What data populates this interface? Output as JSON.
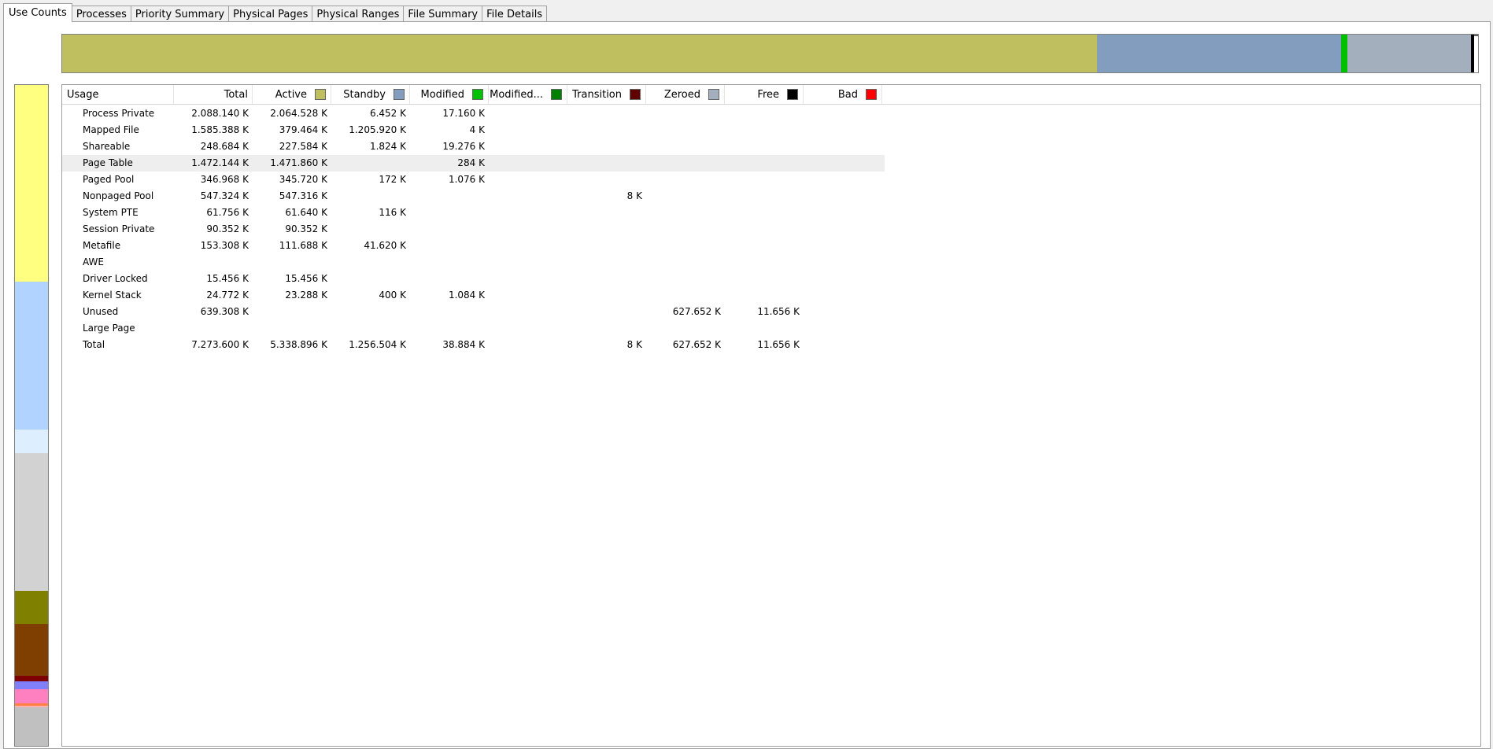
{
  "tabs": [
    {
      "label": "Use Counts",
      "active": true
    },
    {
      "label": "Processes",
      "active": false
    },
    {
      "label": "Priority Summary",
      "active": false
    },
    {
      "label": "Physical Pages",
      "active": false
    },
    {
      "label": "Physical Ranges",
      "active": false
    },
    {
      "label": "File Summary",
      "active": false
    },
    {
      "label": "File Details",
      "active": false
    }
  ],
  "memory_bar": [
    {
      "name": "Active",
      "color": "#bfbf60"
    },
    {
      "name": "Standby",
      "color": "#839dbf"
    },
    {
      "name": "Modified",
      "color": "#00c000"
    },
    {
      "name": "Zeroed",
      "color": "#a3afbd"
    },
    {
      "name": "Free",
      "color": "#000000"
    }
  ],
  "usage_bar": [
    {
      "name": "Process Private",
      "color": "#ffff80"
    },
    {
      "name": "Mapped File",
      "color": "#b0d4ff"
    },
    {
      "name": "Shareable",
      "color": "#dceeff"
    },
    {
      "name": "Page Table",
      "color": "#d2d2d2"
    },
    {
      "name": "Paged Pool",
      "color": "#7f7f00"
    },
    {
      "name": "Nonpaged Pool",
      "color": "#7f3f00"
    },
    {
      "name": "System PTE",
      "color": "#7f0000"
    },
    {
      "name": "Session Private",
      "color": "#8080ff"
    },
    {
      "name": "Metafile",
      "color": "#ff80c0"
    },
    {
      "name": "Driver Locked",
      "color": "#ff8040"
    },
    {
      "name": "Kernel Stack",
      "color": "#ffb0b0"
    },
    {
      "name": "Unused",
      "color": "#c0c0c0"
    }
  ],
  "columns": [
    {
      "label": "Usage",
      "color": null
    },
    {
      "label": "Total",
      "color": null
    },
    {
      "label": "Active",
      "color": "#bfbf60"
    },
    {
      "label": "Standby",
      "color": "#839dbf"
    },
    {
      "label": "Modified",
      "color": "#00c000"
    },
    {
      "label": "Modified...",
      "color": "#008000"
    },
    {
      "label": "Transition",
      "color": "#600000"
    },
    {
      "label": "Zeroed",
      "color": "#a3afbd"
    },
    {
      "label": "Free",
      "color": "#000000"
    },
    {
      "label": "Bad",
      "color": "#ff0000"
    }
  ],
  "rows": [
    [
      "Process Private",
      "2.088.140 K",
      "2.064.528 K",
      "6.452 K",
      "17.160 K",
      "",
      "",
      "",
      "",
      ""
    ],
    [
      "Mapped File",
      "1.585.388 K",
      "379.464 K",
      "1.205.920 K",
      "4 K",
      "",
      "",
      "",
      "",
      ""
    ],
    [
      "Shareable",
      "248.684 K",
      "227.584 K",
      "1.824 K",
      "19.276 K",
      "",
      "",
      "",
      "",
      ""
    ],
    [
      "Page Table",
      "1.472.144 K",
      "1.471.860 K",
      "",
      "284 K",
      "",
      "",
      "",
      "",
      ""
    ],
    [
      "Paged Pool",
      "346.968 K",
      "345.720 K",
      "172 K",
      "1.076 K",
      "",
      "",
      "",
      "",
      ""
    ],
    [
      "Nonpaged Pool",
      "547.324 K",
      "547.316 K",
      "",
      "",
      "",
      "8 K",
      "",
      "",
      ""
    ],
    [
      "System PTE",
      "61.756 K",
      "61.640 K",
      "116 K",
      "",
      "",
      "",
      "",
      "",
      ""
    ],
    [
      "Session Private",
      "90.352 K",
      "90.352 K",
      "",
      "",
      "",
      "",
      "",
      "",
      ""
    ],
    [
      "Metafile",
      "153.308 K",
      "111.688 K",
      "41.620 K",
      "",
      "",
      "",
      "",
      "",
      ""
    ],
    [
      "AWE",
      "",
      "",
      "",
      "",
      "",
      "",
      "",
      "",
      ""
    ],
    [
      "Driver Locked",
      "15.456 K",
      "15.456 K",
      "",
      "",
      "",
      "",
      "",
      "",
      ""
    ],
    [
      "Kernel Stack",
      "24.772 K",
      "23.288 K",
      "400 K",
      "1.084 K",
      "",
      "",
      "",
      "",
      ""
    ],
    [
      "Unused",
      "639.308 K",
      "",
      "",
      "",
      "",
      "",
      "627.652 K",
      "11.656 K",
      ""
    ],
    [
      "Large Page",
      "",
      "",
      "",
      "",
      "",
      "",
      "",
      "",
      ""
    ],
    [
      "Total",
      "7.273.600 K",
      "5.338.896 K",
      "1.256.504 K",
      "38.884 K",
      "",
      "8 K",
      "627.652 K",
      "11.656 K",
      ""
    ]
  ],
  "selected_row": 3
}
